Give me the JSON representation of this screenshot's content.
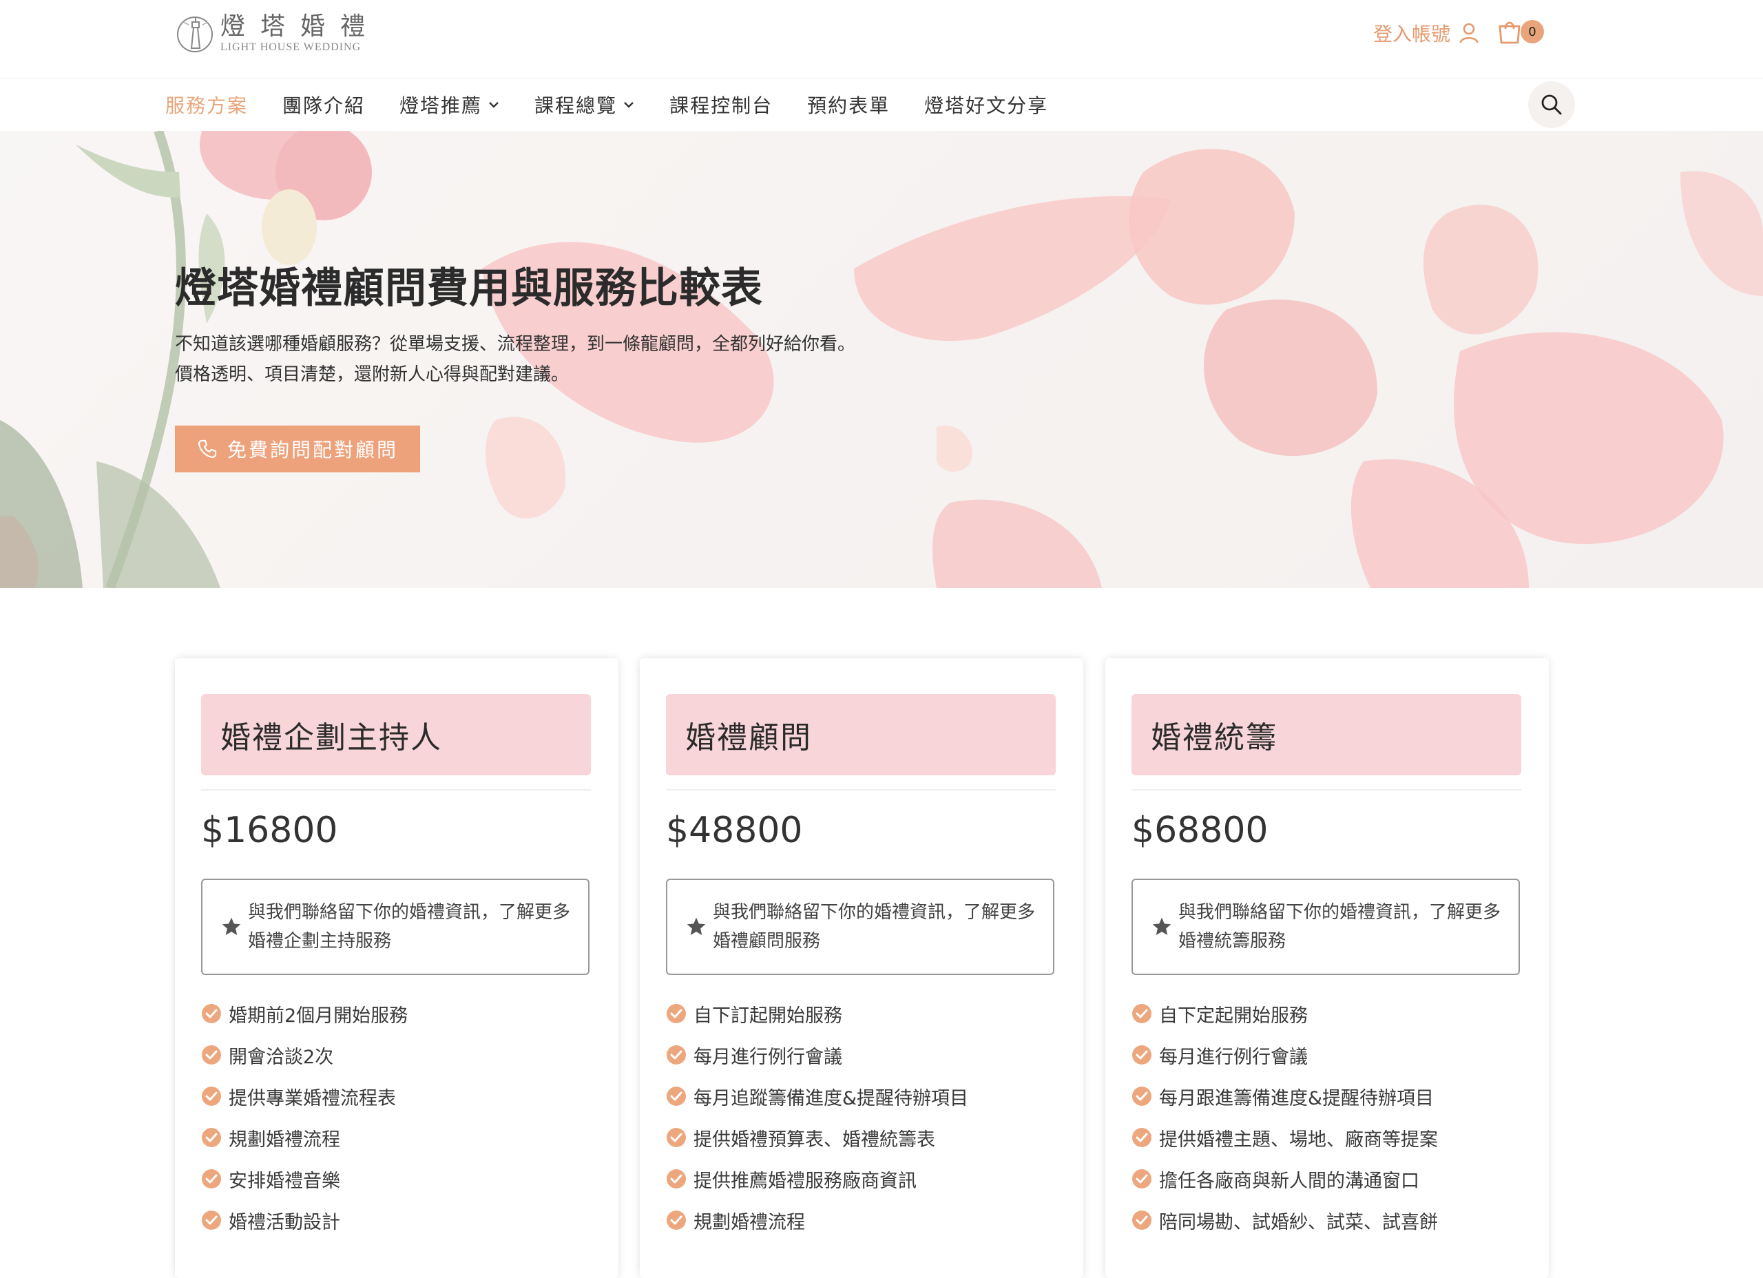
{
  "header": {
    "logo": {
      "cn": "燈塔婚禮",
      "en": "LIGHT HOUSE WEDDING"
    },
    "account_label": "登入帳號",
    "cart_count": "0"
  },
  "nav": {
    "items": [
      {
        "label": "服務方案",
        "active": true,
        "dropdown": false
      },
      {
        "label": "團隊介紹",
        "active": false,
        "dropdown": false
      },
      {
        "label": "燈塔推薦",
        "active": false,
        "dropdown": true
      },
      {
        "label": "課程總覽",
        "active": false,
        "dropdown": true
      },
      {
        "label": "課程控制台",
        "active": false,
        "dropdown": false
      },
      {
        "label": "預約表單",
        "active": false,
        "dropdown": false
      },
      {
        "label": "燈塔好文分享",
        "active": false,
        "dropdown": false
      }
    ]
  },
  "hero": {
    "title": "燈塔婚禮顧問費用與服務比較表",
    "subtitle_line1": "不知道該選哪種婚顧服務？從單場支援、流程整理，到一條龍顧問，全都列好給你看。",
    "subtitle_line2": "價格透明、項目清楚，還附新人心得與配對建議。",
    "cta_label": "免費詢問配對顧問"
  },
  "plans": [
    {
      "title": "婚禮企劃主持人",
      "price": "$16800",
      "info": "與我們聯絡留下你的婚禮資訊，了解更多婚禮企劃主持服務",
      "features": [
        "婚期前2個月開始服務",
        "開會洽談2次",
        "提供專業婚禮流程表",
        "規劃婚禮流程",
        "安排婚禮音樂",
        "婚禮活動設計"
      ]
    },
    {
      "title": "婚禮顧問",
      "price": "$48800",
      "info": "與我們聯絡留下你的婚禮資訊，了解更多婚禮顧問服務",
      "features": [
        "自下訂起開始服務",
        "每月進行例行會議",
        "每月追蹤籌備進度&提醒待辦項目",
        "提供婚禮預算表、婚禮統籌表",
        "提供推薦婚禮服務廠商資訊",
        "規劃婚禮流程"
      ]
    },
    {
      "title": "婚禮統籌",
      "price": "$68800",
      "info": "與我們聯絡留下你的婚禮資訊，了解更多婚禮統籌服務",
      "features": [
        "自下定起開始服務",
        "每月進行例行會議",
        "每月跟進籌備進度&提醒待辦項目",
        "提供婚禮主題、場地、廠商等提案",
        "擔任各廠商與新人間的溝通窗口",
        "陪同場勘、試婚紗、試菜、試喜餅"
      ]
    }
  ],
  "colors": {
    "accent": "#e8a57b",
    "cta": "#eea27c",
    "card_header": "#f7d5d8",
    "check": "#eda77e"
  },
  "icons": [
    "lighthouse-logo-icon",
    "user-icon",
    "cart-icon",
    "chevron-down-icon",
    "search-icon",
    "phone-icon",
    "star-icon",
    "check-circle-icon"
  ]
}
